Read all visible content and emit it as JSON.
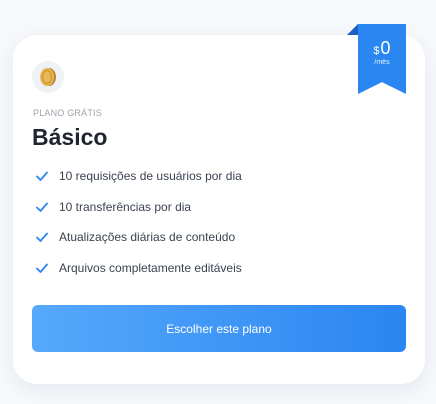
{
  "price": {
    "currency": "$",
    "amount": "0",
    "period": "/mês"
  },
  "plan": {
    "label": "PLANO GRÁTIS",
    "title": "Básico",
    "icon": "coin-icon"
  },
  "features": [
    "10 requisições de usuários por dia",
    "10 transferências por dia",
    "Atualizações diárias de conteúdo",
    "Arquivos completamente editáveis"
  ],
  "cta": {
    "label": "Escolher este plano"
  },
  "colors": {
    "accent": "#2a86f0",
    "check": "#2a86f0",
    "title": "#1f2630",
    "muted": "#9aa3ad"
  }
}
